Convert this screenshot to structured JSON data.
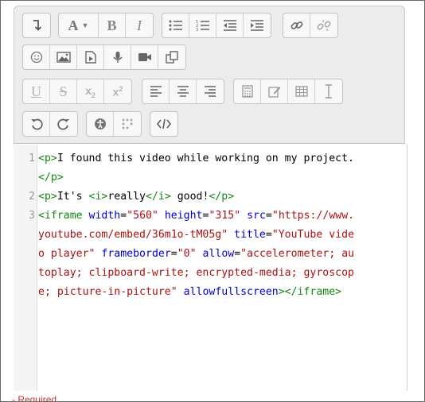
{
  "toolbar": {
    "rows": [
      [
        "collapse-icon",
        "font-style-icon",
        "bold-icon",
        "italic-icon",
        "unordered-list-icon",
        "ordered-list-icon",
        "outdent-icon",
        "indent-icon",
        "link-icon",
        "unlink-icon"
      ],
      [
        "emoji-icon",
        "image-icon",
        "media-icon",
        "record-audio-icon",
        "record-video-icon",
        "manage-files-icon"
      ],
      [
        "underline-icon",
        "strikethrough-icon",
        "subscript-icon",
        "superscript-icon",
        "align-left-icon",
        "align-center-icon",
        "align-right-icon",
        "equation-icon",
        "edit-icon",
        "table-icon",
        "clear-formatting-icon"
      ],
      [
        "undo-icon",
        "redo-icon",
        "accessibility-icon",
        "screenreader-icon",
        "html-icon"
      ]
    ],
    "bold_label": "B",
    "italic_label": "I",
    "font_label": "A",
    "underline_label": "U",
    "strike_label": "S",
    "sub_label": "x",
    "sub_index": "2",
    "sup_label": "x",
    "sup_index": "2"
  },
  "editor": {
    "line_numbers": [
      "1",
      "2",
      "3"
    ],
    "lines": {
      "l1a": "<p>",
      "l1b": "I found this video while working on my project.",
      "l1c": "</p>",
      "l2a": "<p>",
      "l2b": "It's ",
      "l2c": "<i>",
      "l2d": "really",
      "l2e": "</i>",
      "l2f": " good!",
      "l2g": "</p>",
      "l3_tag_open": "<iframe",
      "l3_attr_width": "width",
      "l3_val_width": "\"560\"",
      "l3_attr_height": "height",
      "l3_val_height": "\"315\"",
      "l3_attr_src": "src",
      "l3_val_src_1": "\"https://www.",
      "l3_val_src_2": "youtube.com/embed/36m1o-tM05g\"",
      "l3_attr_title": "title",
      "l3_val_title_1": "\"YouTube vide",
      "l3_val_title_2": "o player\"",
      "l3_attr_frameborder": "frameborder",
      "l3_val_frameborder": "\"0\"",
      "l3_attr_allow": "allow",
      "l3_val_allow_1": "\"accelerometer; au",
      "l3_val_allow_2": "toplay; clipboard-write; encrypted-media; gyroscop",
      "l3_val_allow_3": "e; picture-in-picture\"",
      "l3_attr_allowfullscreen": "allowfullscreen",
      "l3_tag_close": "></iframe>"
    }
  },
  "footer": {
    "required_label": "Required"
  }
}
